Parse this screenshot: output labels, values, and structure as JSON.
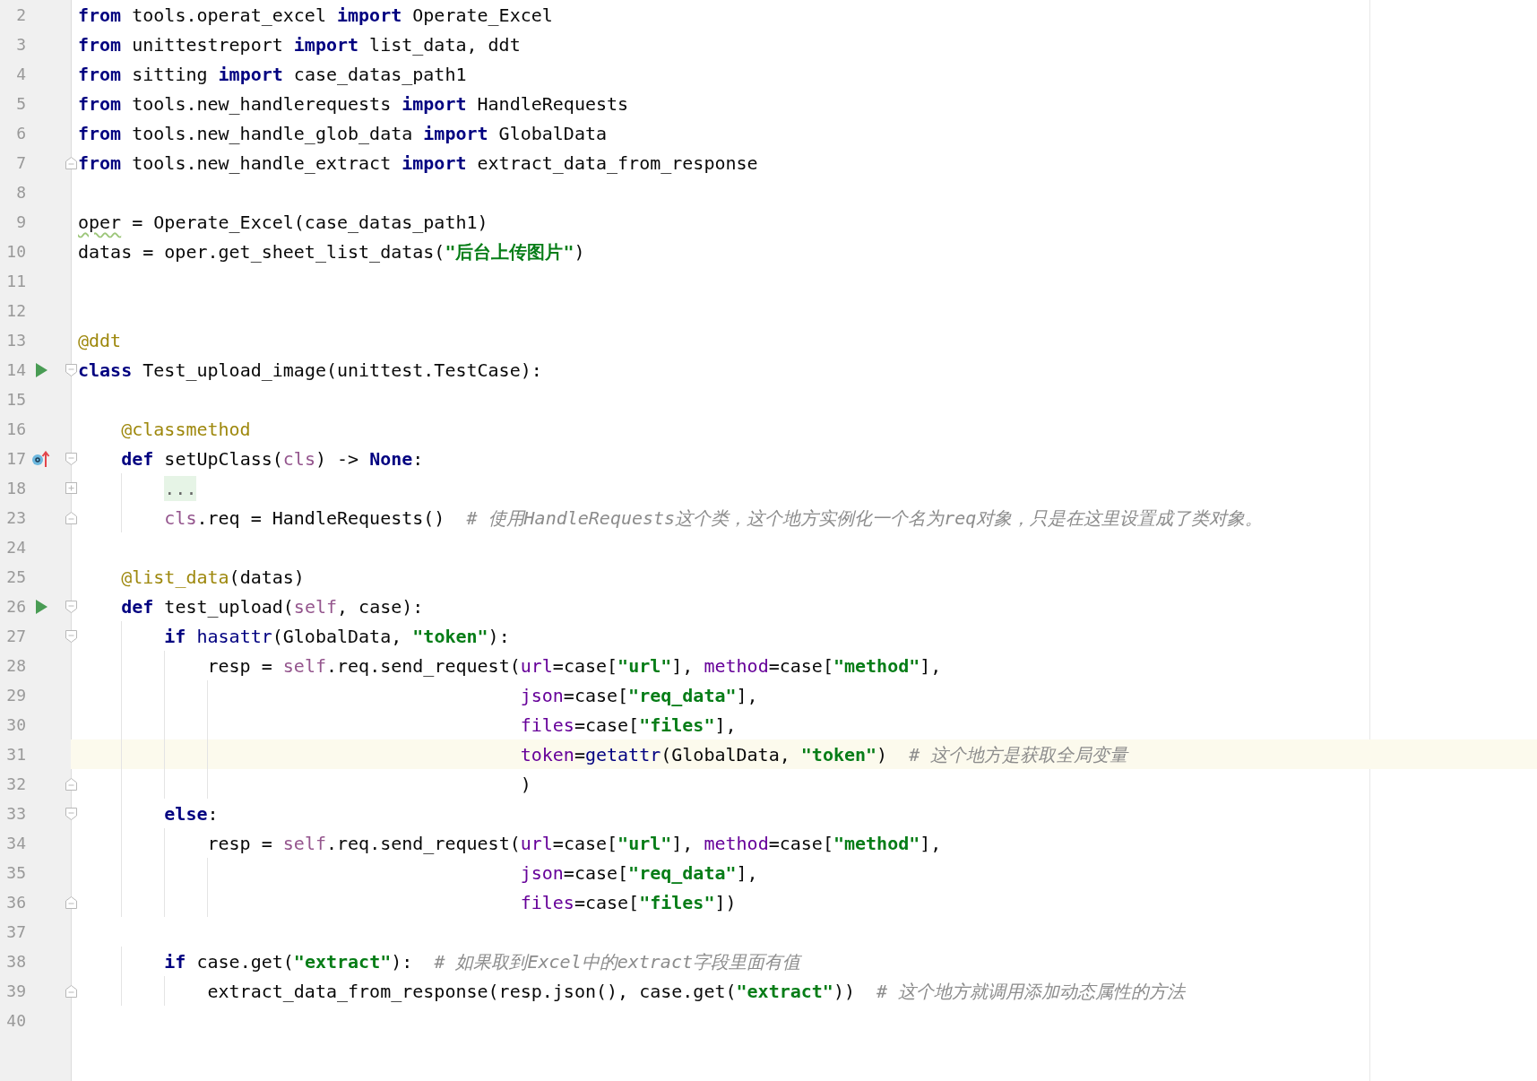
{
  "editor": {
    "lines": [
      {
        "number": "2",
        "current": false,
        "tokens": [
          {
            "text": "from",
            "kind": "kw"
          },
          {
            "text": " tools.operat_excel ",
            "kind": "plain"
          },
          {
            "text": "import",
            "kind": "kw"
          },
          {
            "text": " Operate_Excel",
            "kind": "plain"
          }
        ]
      },
      {
        "number": "3",
        "current": false,
        "tokens": [
          {
            "text": "from",
            "kind": "kw"
          },
          {
            "text": " unittestreport ",
            "kind": "plain"
          },
          {
            "text": "import",
            "kind": "kw"
          },
          {
            "text": " list_data, ddt",
            "kind": "plain"
          }
        ]
      },
      {
        "number": "4",
        "current": false,
        "tokens": [
          {
            "text": "from",
            "kind": "kw"
          },
          {
            "text": " sitting ",
            "kind": "plain"
          },
          {
            "text": "import",
            "kind": "kw"
          },
          {
            "text": " case_datas_path1",
            "kind": "plain"
          }
        ]
      },
      {
        "number": "5",
        "current": false,
        "tokens": [
          {
            "text": "from",
            "kind": "kw"
          },
          {
            "text": " tools.new_handlerequests ",
            "kind": "plain"
          },
          {
            "text": "import",
            "kind": "kw"
          },
          {
            "text": " HandleRequests",
            "kind": "plain"
          }
        ]
      },
      {
        "number": "6",
        "current": false,
        "tokens": [
          {
            "text": "from",
            "kind": "kw"
          },
          {
            "text": " tools.new_handle_glob_data ",
            "kind": "plain"
          },
          {
            "text": "import",
            "kind": "kw"
          },
          {
            "text": " GlobalData",
            "kind": "plain"
          }
        ]
      },
      {
        "number": "7",
        "current": false,
        "fold_marker": {
          "kind": "end"
        },
        "tokens": [
          {
            "text": "from",
            "kind": "kw"
          },
          {
            "text": " tools.new_handle_extract ",
            "kind": "plain"
          },
          {
            "text": "import",
            "kind": "kw"
          },
          {
            "text": " extract_data_from_response",
            "kind": "plain"
          }
        ]
      },
      {
        "number": "8",
        "current": false
      },
      {
        "number": "9",
        "current": false,
        "tokens": [
          {
            "text": "oper",
            "kind": "warn"
          },
          {
            "text": " = Operate_Excel(case_datas_path1)",
            "kind": "plain"
          }
        ]
      },
      {
        "number": "10",
        "current": false,
        "tokens": [
          {
            "text": "datas = oper.get_sheet_list_datas(",
            "kind": "plain"
          },
          {
            "text": "\"后台上传图片\"",
            "kind": "str"
          },
          {
            "text": ")",
            "kind": "plain"
          }
        ]
      },
      {
        "number": "11",
        "current": false
      },
      {
        "number": "12",
        "current": false
      },
      {
        "number": "13",
        "current": false,
        "tokens": [
          {
            "text": "@ddt",
            "kind": "dec"
          }
        ]
      },
      {
        "number": "14",
        "current": false,
        "gutter_icon": {
          "kind": "run"
        },
        "fold_marker": {
          "kind": "start"
        },
        "tokens": [
          {
            "text": "class",
            "kind": "kw"
          },
          {
            "text": " Test_upload_image(unittest.TestCase):",
            "kind": "plain"
          }
        ],
        "children": [
          {
            "number": "15",
            "current": false
          },
          {
            "number": "16",
            "current": false,
            "tokens": [
              {
                "text": "@classmethod",
                "kind": "dec"
              }
            ]
          },
          {
            "number": "17",
            "current": false,
            "gutter_icon": {
              "kind": "override"
            },
            "fold_marker": {
              "kind": "start"
            },
            "tokens": [
              {
                "text": "def",
                "kind": "kw"
              },
              {
                "text": " setUpClass(",
                "kind": "plain"
              },
              {
                "text": "cls",
                "kind": "self"
              },
              {
                "text": ") -> ",
                "kind": "plain"
              },
              {
                "text": "None",
                "kind": "kw"
              },
              {
                "text": ":",
                "kind": "plain"
              }
            ],
            "children": [
              {
                "number": "18",
                "current": false,
                "fold_marker": {
                  "kind": "collapsed"
                },
                "tokens": [
                  {
                    "text": "...",
                    "kind": "folded"
                  }
                ]
              },
              {
                "number": "23",
                "current": false,
                "fold_marker": {
                  "kind": "end"
                },
                "tokens": [
                  {
                    "text": "cls",
                    "kind": "self"
                  },
                  {
                    "text": ".req = HandleRequests()  ",
                    "kind": "plain"
                  },
                  {
                    "text": "# 使用HandleRequests这个类，这个地方实例化一个名为req对象，只是在这里设置成了类对象。",
                    "kind": "cmt"
                  }
                ]
              }
            ]
          },
          {
            "number": "24",
            "current": false
          },
          {
            "number": "25",
            "current": false,
            "tokens": [
              {
                "text": "@list_data",
                "kind": "dec"
              },
              {
                "text": "(datas)",
                "kind": "plain"
              }
            ]
          },
          {
            "number": "26",
            "current": false,
            "gutter_icon": {
              "kind": "run"
            },
            "fold_marker": {
              "kind": "start"
            },
            "tokens": [
              {
                "text": "def",
                "kind": "kw"
              },
              {
                "text": " test_upload(",
                "kind": "plain"
              },
              {
                "text": "self",
                "kind": "self"
              },
              {
                "text": ", case):",
                "kind": "plain"
              }
            ],
            "children": [
              {
                "number": "27",
                "current": false,
                "fold_marker": {
                  "kind": "start"
                },
                "tokens": [
                  {
                    "text": "if",
                    "kind": "kw"
                  },
                  {
                    "text": " hasattr",
                    "kind": "builtin"
                  },
                  {
                    "text": "(GlobalData, ",
                    "kind": "plain"
                  },
                  {
                    "text": "\"token\"",
                    "kind": "str"
                  },
                  {
                    "text": "):",
                    "kind": "plain"
                  }
                ],
                "children": [
                  {
                    "number": "28",
                    "current": false,
                    "tokens": [
                      {
                        "text": "resp = ",
                        "kind": "plain"
                      },
                      {
                        "text": "self",
                        "kind": "self"
                      },
                      {
                        "text": ".req.send_request(",
                        "kind": "plain"
                      },
                      {
                        "text": "url",
                        "kind": "param"
                      },
                      {
                        "text": "=case[",
                        "kind": "plain"
                      },
                      {
                        "text": "\"url\"",
                        "kind": "str"
                      },
                      {
                        "text": "], ",
                        "kind": "plain"
                      },
                      {
                        "text": "method",
                        "kind": "param"
                      },
                      {
                        "text": "=case[",
                        "kind": "plain"
                      },
                      {
                        "text": "\"method\"",
                        "kind": "str"
                      },
                      {
                        "text": "],",
                        "kind": "plain"
                      }
                    ],
                    "continuation": [
                      {
                        "number": "29",
                        "current": false,
                        "tokens": [
                          {
                            "text": "json",
                            "kind": "param"
                          },
                          {
                            "text": "=case[",
                            "kind": "plain"
                          },
                          {
                            "text": "\"req_data\"",
                            "kind": "str"
                          },
                          {
                            "text": "],",
                            "kind": "plain"
                          }
                        ]
                      },
                      {
                        "number": "30",
                        "current": false,
                        "tokens": [
                          {
                            "text": "files",
                            "kind": "param"
                          },
                          {
                            "text": "=case[",
                            "kind": "plain"
                          },
                          {
                            "text": "\"files\"",
                            "kind": "str"
                          },
                          {
                            "text": "],",
                            "kind": "plain"
                          }
                        ]
                      },
                      {
                        "number": "31",
                        "current": true,
                        "tokens": [
                          {
                            "text": "token",
                            "kind": "param"
                          },
                          {
                            "text": "=",
                            "kind": "plain"
                          },
                          {
                            "text": "getattr",
                            "kind": "builtin"
                          },
                          {
                            "text": "(GlobalData, ",
                            "kind": "plain"
                          },
                          {
                            "text": "\"token\"",
                            "kind": "str"
                          },
                          {
                            "text": ")  ",
                            "kind": "plain"
                          },
                          {
                            "text": "# 这个地方是获取全局变量",
                            "kind": "cmt"
                          }
                        ]
                      },
                      {
                        "number": "32",
                        "current": false,
                        "fold_marker": {
                          "kind": "end"
                        },
                        "tokens": [
                          {
                            "text": ")",
                            "kind": "plain"
                          }
                        ]
                      }
                    ]
                  }
                ]
              },
              {
                "number": "33",
                "current": false,
                "fold_marker": {
                  "kind": "start"
                },
                "tokens": [
                  {
                    "text": "else",
                    "kind": "kw"
                  },
                  {
                    "text": ":",
                    "kind": "plain"
                  }
                ],
                "children": [
                  {
                    "number": "34",
                    "current": false,
                    "tokens": [
                      {
                        "text": "resp = ",
                        "kind": "plain"
                      },
                      {
                        "text": "self",
                        "kind": "self"
                      },
                      {
                        "text": ".req.send_request(",
                        "kind": "plain"
                      },
                      {
                        "text": "url",
                        "kind": "param"
                      },
                      {
                        "text": "=case[",
                        "kind": "plain"
                      },
                      {
                        "text": "\"url\"",
                        "kind": "str"
                      },
                      {
                        "text": "], ",
                        "kind": "plain"
                      },
                      {
                        "text": "method",
                        "kind": "param"
                      },
                      {
                        "text": "=case[",
                        "kind": "plain"
                      },
                      {
                        "text": "\"method\"",
                        "kind": "str"
                      },
                      {
                        "text": "],",
                        "kind": "plain"
                      }
                    ],
                    "continuation": [
                      {
                        "number": "35",
                        "current": false,
                        "tokens": [
                          {
                            "text": "json",
                            "kind": "param"
                          },
                          {
                            "text": "=case[",
                            "kind": "plain"
                          },
                          {
                            "text": "\"req_data\"",
                            "kind": "str"
                          },
                          {
                            "text": "],",
                            "kind": "plain"
                          }
                        ]
                      },
                      {
                        "number": "36",
                        "current": false,
                        "fold_marker": {
                          "kind": "end"
                        },
                        "tokens": [
                          {
                            "text": "files",
                            "kind": "param"
                          },
                          {
                            "text": "=case[",
                            "kind": "plain"
                          },
                          {
                            "text": "\"files\"",
                            "kind": "str"
                          },
                          {
                            "text": "])",
                            "kind": "plain"
                          }
                        ]
                      }
                    ]
                  }
                ]
              },
              {
                "number": "37",
                "current": false
              },
              {
                "number": "38",
                "current": false,
                "tokens": [
                  {
                    "text": "if",
                    "kind": "kw"
                  },
                  {
                    "text": " case.get(",
                    "kind": "plain"
                  },
                  {
                    "text": "\"extract\"",
                    "kind": "str"
                  },
                  {
                    "text": "):  ",
                    "kind": "plain"
                  },
                  {
                    "text": "# 如果取到Excel中的extract字段里面有值",
                    "kind": "cmt"
                  }
                ],
                "children": [
                  {
                    "number": "39",
                    "current": false,
                    "fold_marker": {
                      "kind": "end"
                    },
                    "tokens": [
                      {
                        "text": "extract_data_from_response(resp.json(), case.get(",
                        "kind": "plain"
                      },
                      {
                        "text": "\"extract\"",
                        "kind": "str"
                      },
                      {
                        "text": "))  ",
                        "kind": "plain"
                      },
                      {
                        "text": "# 这个地方就调用添加动态属性的方法",
                        "kind": "cmt"
                      }
                    ]
                  }
                ]
              },
              {
                "number": "40",
                "current": false
              }
            ]
          }
        ]
      }
    ]
  }
}
